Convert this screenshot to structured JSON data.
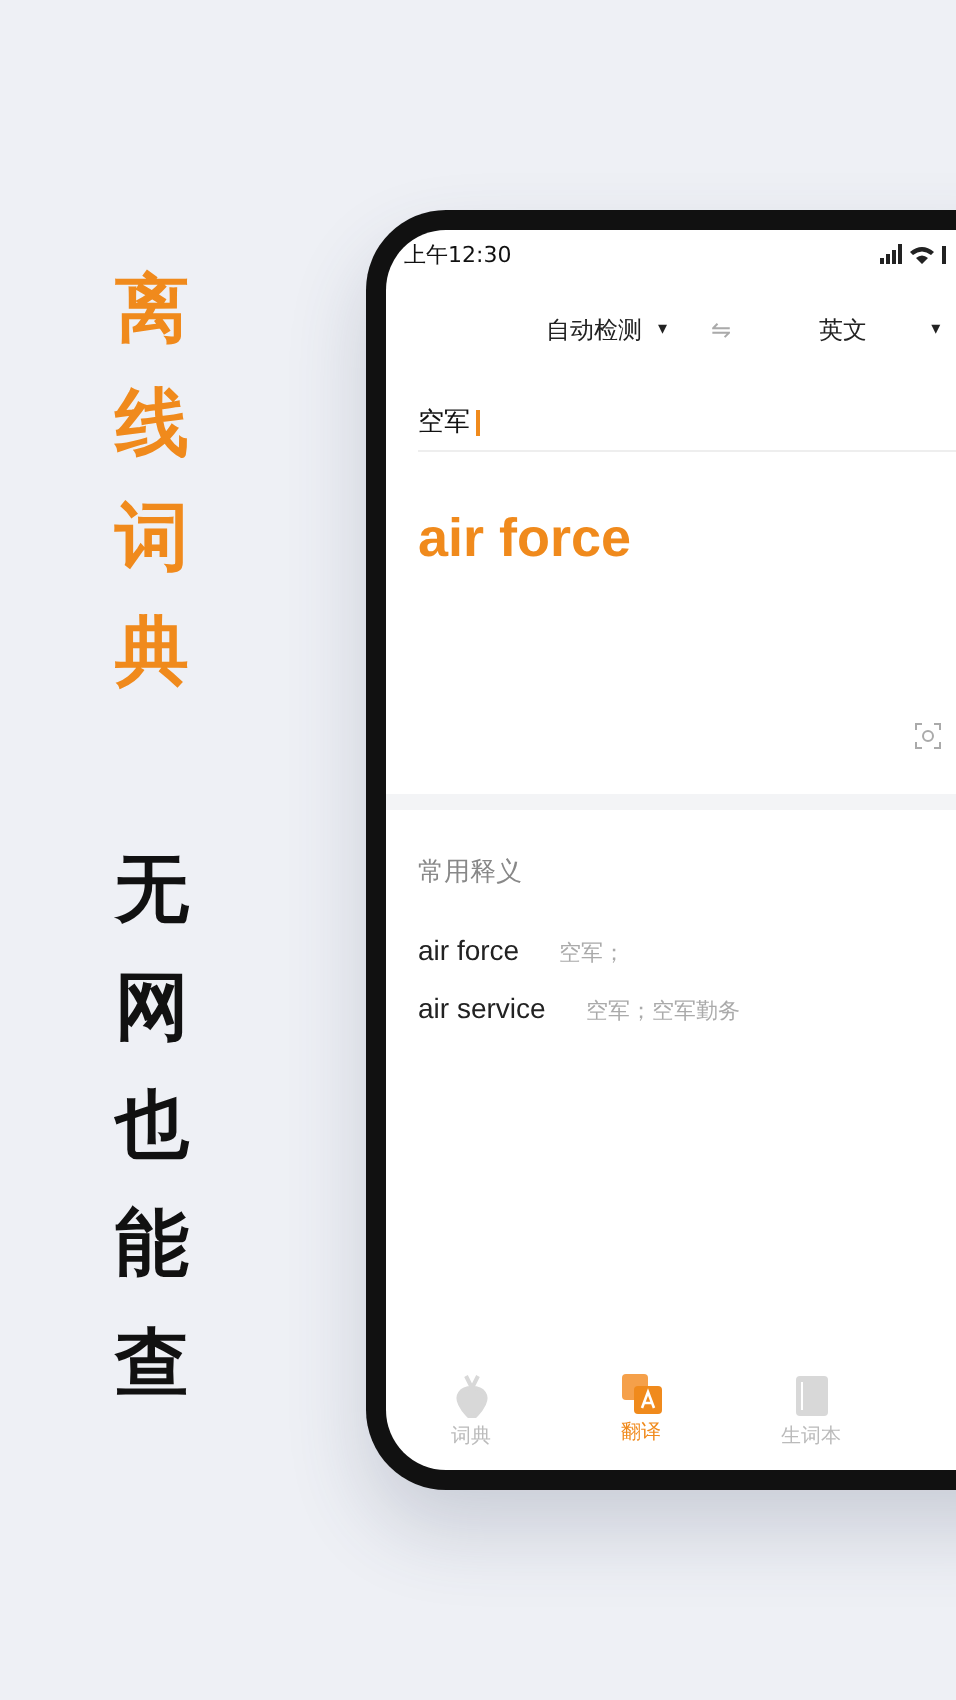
{
  "slogan": {
    "highlight": "离线词典",
    "tagline": "无网也能查"
  },
  "status_bar": {
    "time": "上午12:30"
  },
  "language_bar": {
    "source": "自动检测",
    "source_caret": "▾",
    "swap": "⇋",
    "target": "英文",
    "target_caret": "▾"
  },
  "input": {
    "value": "空军"
  },
  "result": {
    "translation": "air force"
  },
  "common_meanings": {
    "title": "常用释义",
    "items": [
      {
        "term": "air force",
        "meaning": "空军；"
      },
      {
        "term": "air service",
        "meaning": "空军；空军勤务"
      }
    ]
  },
  "bottom_nav": [
    {
      "label": "词典",
      "kind": "dictionary",
      "selected": false
    },
    {
      "label": "翻译",
      "kind": "translate",
      "selected": true
    },
    {
      "label": "生词本",
      "kind": "notebook",
      "selected": false
    }
  ]
}
